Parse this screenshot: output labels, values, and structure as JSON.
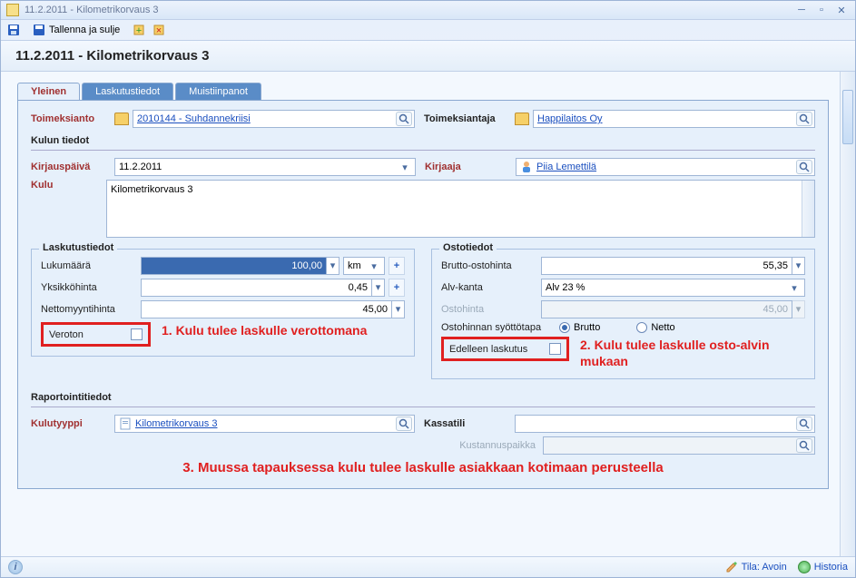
{
  "window": {
    "title": "11.2.2011 - Kilometrikorvaus 3"
  },
  "toolbar": {
    "save_and_close": "Tallenna ja sulje"
  },
  "header": "11.2.2011 - Kilometrikorvaus 3",
  "tabs": {
    "general": "Yleinen",
    "billing": "Laskutustiedot",
    "notes": "Muistiinpanot"
  },
  "assignment": {
    "label": "Toimeksianto",
    "value": "2010144 - Suhdannekriisi",
    "client_label": "Toimeksiantaja",
    "client_value": "Happilaitos Oy"
  },
  "expense_section": {
    "title": "Kulun tiedot",
    "date_label": "Kirjauspäivä",
    "date_value": "11.2.2011",
    "recorder_label": "Kirjaaja",
    "recorder_value": "Piia Lemettilä",
    "expense_label": "Kulu",
    "expense_value": "Kilometrikorvaus 3"
  },
  "billing_box": {
    "legend": "Laskutustiedot",
    "qty_label": "Lukumäärä",
    "qty_value": "100,00",
    "qty_unit": "km",
    "unit_price_label": "Yksikköhinta",
    "unit_price_value": "0,45",
    "net_label": "Nettomyyntihinta",
    "net_value": "45,00",
    "taxfree_label": "Veroton"
  },
  "purchase_box": {
    "legend": "Ostotiedot",
    "gross_label": "Brutto-ostohinta",
    "gross_value": "55,35",
    "vat_label": "Alv-kanta",
    "vat_value": "Alv 23 %",
    "price_label": "Ostohinta",
    "price_value": "45,00",
    "entry_label": "Ostohinnan syöttötapa",
    "brutto": "Brutto",
    "netto": "Netto",
    "rebill_label": "Edelleen laskutus"
  },
  "report_box": {
    "title": "Raportointitiedot",
    "type_label": "Kulutyyppi",
    "type_value": "Kilometrikorvaus 3",
    "acct_label": "Kassatili",
    "cc_label": "Kustannuspaikka"
  },
  "annotations": {
    "a1": "1. Kulu tulee laskulle verottomana",
    "a2": "2. Kulu tulee laskulle osto-alvin mukaan",
    "a3": "3. Muussa tapauksessa kulu tulee laskulle asiakkaan kotimaan perusteella"
  },
  "status": {
    "state_label": "Tila: Avoin",
    "history": "Historia"
  }
}
